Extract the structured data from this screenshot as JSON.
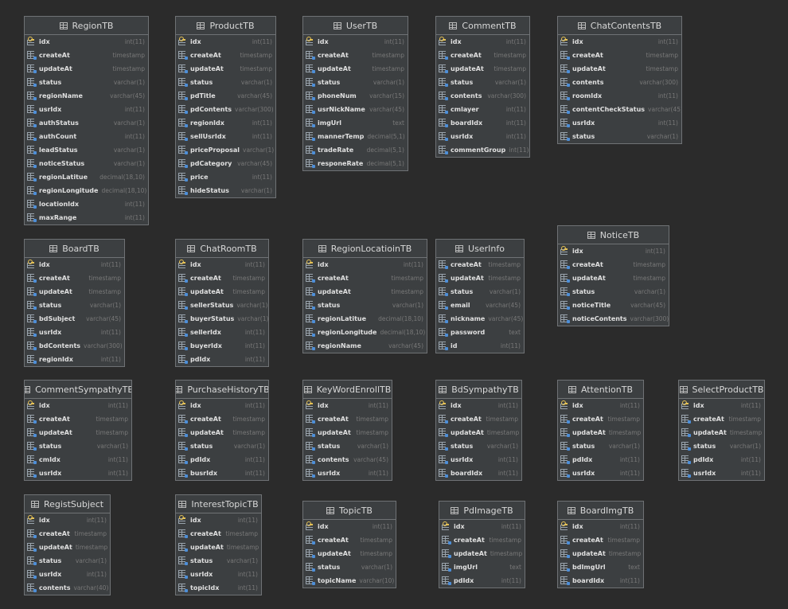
{
  "tables": [
    {
      "name": "RegionTB",
      "columns": [
        {
          "name": "idx",
          "type": "int(11)",
          "pk": true
        },
        {
          "name": "createAt",
          "type": "timestamp"
        },
        {
          "name": "updateAt",
          "type": "timestamp"
        },
        {
          "name": "status",
          "type": "varchar(1)"
        },
        {
          "name": "regionName",
          "type": "varchar(45)"
        },
        {
          "name": "usrIdx",
          "type": "int(11)"
        },
        {
          "name": "authStatus",
          "type": "varchar(1)"
        },
        {
          "name": "authCount",
          "type": "int(11)"
        },
        {
          "name": "leadStatus",
          "type": "varchar(1)"
        },
        {
          "name": "noticeStatus",
          "type": "varchar(1)"
        },
        {
          "name": "regionLatitue",
          "type": "decimal(18,10)"
        },
        {
          "name": "regionLongitude",
          "type": "decimal(18,10)"
        },
        {
          "name": "locationIdx",
          "type": "int(11)"
        },
        {
          "name": "maxRange",
          "type": "int(11)"
        }
      ]
    },
    {
      "name": "ProductTB",
      "columns": [
        {
          "name": "idx",
          "type": "int(11)",
          "pk": true
        },
        {
          "name": "createAt",
          "type": "timestamp"
        },
        {
          "name": "updateAt",
          "type": "timestamp"
        },
        {
          "name": "status",
          "type": "varchar(1)"
        },
        {
          "name": "pdTitle",
          "type": "varchar(45)"
        },
        {
          "name": "pdContents",
          "type": "varchar(300)"
        },
        {
          "name": "regionIdx",
          "type": "int(11)"
        },
        {
          "name": "sellUsrIdx",
          "type": "int(11)"
        },
        {
          "name": "priceProposal",
          "type": "varchar(1)"
        },
        {
          "name": "pdCategory",
          "type": "varchar(45)"
        },
        {
          "name": "price",
          "type": "int(11)"
        },
        {
          "name": "hideStatus",
          "type": "varchar(1)"
        }
      ]
    },
    {
      "name": "UserTB",
      "columns": [
        {
          "name": "idx",
          "type": "int(11)",
          "pk": true
        },
        {
          "name": "createAt",
          "type": "timestamp"
        },
        {
          "name": "updateAt",
          "type": "timestamp"
        },
        {
          "name": "status",
          "type": "varchar(1)"
        },
        {
          "name": "phoneNum",
          "type": "varchar(15)"
        },
        {
          "name": "usrNickName",
          "type": "varchar(45)"
        },
        {
          "name": "imgUrl",
          "type": "text"
        },
        {
          "name": "mannerTemp",
          "type": "decimal(5,1)"
        },
        {
          "name": "tradeRate",
          "type": "decimal(5,1)"
        },
        {
          "name": "responeRate",
          "type": "decimal(5,1)"
        }
      ]
    },
    {
      "name": "CommentTB",
      "columns": [
        {
          "name": "idx",
          "type": "int(11)",
          "pk": true
        },
        {
          "name": "createAt",
          "type": "timestamp"
        },
        {
          "name": "updateAt",
          "type": "timestamp"
        },
        {
          "name": "status",
          "type": "varchar(1)"
        },
        {
          "name": "contents",
          "type": "varchar(300)"
        },
        {
          "name": "cmlayer",
          "type": "int(11)"
        },
        {
          "name": "boardIdx",
          "type": "int(11)"
        },
        {
          "name": "usrIdx",
          "type": "int(11)"
        },
        {
          "name": "commentGroup",
          "type": "int(11)"
        }
      ]
    },
    {
      "name": "ChatContentsTB",
      "columns": [
        {
          "name": "idx",
          "type": "int(11)",
          "pk": true
        },
        {
          "name": "createAt",
          "type": "timestamp"
        },
        {
          "name": "updateAt",
          "type": "timestamp"
        },
        {
          "name": "contents",
          "type": "varchar(300)"
        },
        {
          "name": "roomIdx",
          "type": "int(11)"
        },
        {
          "name": "contentCheckStatus",
          "type": "varchar(45)"
        },
        {
          "name": "usrIdx",
          "type": "int(11)"
        },
        {
          "name": "status",
          "type": "varchar(1)"
        }
      ]
    },
    {
      "name": "BoardTB",
      "columns": [
        {
          "name": "idx",
          "type": "int(11)",
          "pk": true
        },
        {
          "name": "createAt",
          "type": "timestamp"
        },
        {
          "name": "updateAt",
          "type": "timestamp"
        },
        {
          "name": "status",
          "type": "varchar(1)"
        },
        {
          "name": "bdSubject",
          "type": "varchar(45)"
        },
        {
          "name": "usrIdx",
          "type": "int(11)"
        },
        {
          "name": "bdContents",
          "type": "varchar(300)"
        },
        {
          "name": "regionIdx",
          "type": "int(11)"
        }
      ]
    },
    {
      "name": "ChatRoomTB",
      "columns": [
        {
          "name": "idx",
          "type": "int(11)",
          "pk": true
        },
        {
          "name": "createAt",
          "type": "timestamp"
        },
        {
          "name": "updateAt",
          "type": "timestamp"
        },
        {
          "name": "sellerStatus",
          "type": "varchar(1)"
        },
        {
          "name": "buyerStatus",
          "type": "varchar(1)"
        },
        {
          "name": "sellerIdx",
          "type": "int(11)"
        },
        {
          "name": "buyerIdx",
          "type": "int(11)"
        },
        {
          "name": "pdIdx",
          "type": "int(11)"
        }
      ]
    },
    {
      "name": "RegionLocatioinTB",
      "columns": [
        {
          "name": "idx",
          "type": "int(11)",
          "pk": true
        },
        {
          "name": "createAt",
          "type": "timestamp"
        },
        {
          "name": "updateAt",
          "type": "timestamp"
        },
        {
          "name": "status",
          "type": "varchar(1)"
        },
        {
          "name": "regionLatitue",
          "type": "decimal(18,10)"
        },
        {
          "name": "regionLongitude",
          "type": "decimal(18,10)"
        },
        {
          "name": "regionName",
          "type": "varchar(45)"
        }
      ]
    },
    {
      "name": "UserInfo",
      "columns": [
        {
          "name": "createAt",
          "type": "timestamp"
        },
        {
          "name": "updateAt",
          "type": "timestamp"
        },
        {
          "name": "status",
          "type": "varchar(1)"
        },
        {
          "name": "email",
          "type": "varchar(45)"
        },
        {
          "name": "nickname",
          "type": "varchar(45)"
        },
        {
          "name": "password",
          "type": "text"
        },
        {
          "name": "id",
          "type": "int(11)"
        }
      ]
    },
    {
      "name": "NoticeTB",
      "columns": [
        {
          "name": "idx",
          "type": "int(11)",
          "pk": true
        },
        {
          "name": "createAt",
          "type": "timestamp"
        },
        {
          "name": "updateAt",
          "type": "timestamp"
        },
        {
          "name": "status",
          "type": "varchar(1)"
        },
        {
          "name": "noticeTitle",
          "type": "varchar(45)"
        },
        {
          "name": "noticeContents",
          "type": "varchar(300)"
        }
      ]
    },
    {
      "name": "CommentSympathyTB",
      "columns": [
        {
          "name": "idx",
          "type": "int(11)",
          "pk": true
        },
        {
          "name": "createAt",
          "type": "timestamp"
        },
        {
          "name": "updateAt",
          "type": "timestamp"
        },
        {
          "name": "status",
          "type": "varchar(1)"
        },
        {
          "name": "cmIdx",
          "type": "int(11)"
        },
        {
          "name": "usrIdx",
          "type": "int(11)"
        }
      ]
    },
    {
      "name": "PurchaseHistoryTB",
      "columns": [
        {
          "name": "idx",
          "type": "int(11)",
          "pk": true
        },
        {
          "name": "createAt",
          "type": "timestamp"
        },
        {
          "name": "updateAt",
          "type": "timestamp"
        },
        {
          "name": "status",
          "type": "varchar(1)"
        },
        {
          "name": "pdIdx",
          "type": "int(11)"
        },
        {
          "name": "busrIdx",
          "type": "int(11)"
        }
      ]
    },
    {
      "name": "KeyWordEnrollTB",
      "columns": [
        {
          "name": "idx",
          "type": "int(11)",
          "pk": true
        },
        {
          "name": "createAt",
          "type": "timestamp"
        },
        {
          "name": "updateAt",
          "type": "timestamp"
        },
        {
          "name": "status",
          "type": "varchar(1)"
        },
        {
          "name": "contents",
          "type": "varchar(45)"
        },
        {
          "name": "usrIdx",
          "type": "int(11)"
        }
      ]
    },
    {
      "name": "BdSympathyTB",
      "columns": [
        {
          "name": "idx",
          "type": "int(11)",
          "pk": true
        },
        {
          "name": "createAt",
          "type": "timestamp"
        },
        {
          "name": "updateAt",
          "type": "timestamp"
        },
        {
          "name": "status",
          "type": "varchar(1)"
        },
        {
          "name": "usrIdx",
          "type": "int(11)"
        },
        {
          "name": "boardIdx",
          "type": "int(11)"
        }
      ]
    },
    {
      "name": "AttentionTB",
      "columns": [
        {
          "name": "idx",
          "type": "int(11)",
          "pk": true
        },
        {
          "name": "createAt",
          "type": "timestamp"
        },
        {
          "name": "updateAt",
          "type": "timestamp"
        },
        {
          "name": "status",
          "type": "varchar(1)"
        },
        {
          "name": "pdIdx",
          "type": "int(11)"
        },
        {
          "name": "usrIdx",
          "type": "int(11)"
        }
      ]
    },
    {
      "name": "SelectProductTB",
      "columns": [
        {
          "name": "idx",
          "type": "int(11)",
          "pk": true
        },
        {
          "name": "createAt",
          "type": "timestamp"
        },
        {
          "name": "updateAt",
          "type": "timestamp"
        },
        {
          "name": "status",
          "type": "varchar(1)"
        },
        {
          "name": "pdIdx",
          "type": "int(11)"
        },
        {
          "name": "usrIdx",
          "type": "int(11)"
        }
      ]
    },
    {
      "name": "RegistSubject",
      "columns": [
        {
          "name": "idx",
          "type": "int(11)",
          "pk": true
        },
        {
          "name": "createAt",
          "type": "timestamp"
        },
        {
          "name": "updateAt",
          "type": "timestamp"
        },
        {
          "name": "status",
          "type": "varchar(1)"
        },
        {
          "name": "usrIdx",
          "type": "int(11)"
        },
        {
          "name": "contents",
          "type": "varchar(40)"
        }
      ]
    },
    {
      "name": "InterestTopicTB",
      "columns": [
        {
          "name": "idx",
          "type": "int(11)",
          "pk": true
        },
        {
          "name": "createAt",
          "type": "timestamp"
        },
        {
          "name": "updateAt",
          "type": "timestamp"
        },
        {
          "name": "status",
          "type": "varchar(1)"
        },
        {
          "name": "usrIdx",
          "type": "int(11)"
        },
        {
          "name": "topicIdx",
          "type": "int(11)"
        }
      ]
    },
    {
      "name": "TopicTB",
      "columns": [
        {
          "name": "idx",
          "type": "int(11)",
          "pk": true
        },
        {
          "name": "createAt",
          "type": "timestamp"
        },
        {
          "name": "updateAt",
          "type": "timestamp"
        },
        {
          "name": "status",
          "type": "varchar(1)"
        },
        {
          "name": "topicName",
          "type": "varchar(10)"
        }
      ]
    },
    {
      "name": "PdImageTB",
      "columns": [
        {
          "name": "idx",
          "type": "int(11)",
          "pk": true
        },
        {
          "name": "createAt",
          "type": "timestamp"
        },
        {
          "name": "updateAt",
          "type": "timestamp"
        },
        {
          "name": "imgUrl",
          "type": "text"
        },
        {
          "name": "pdIdx",
          "type": "int(11)"
        }
      ]
    },
    {
      "name": "BoardImgTB",
      "columns": [
        {
          "name": "idx",
          "type": "int(11)",
          "pk": true
        },
        {
          "name": "createAt",
          "type": "timestamp"
        },
        {
          "name": "updateAt",
          "type": "timestamp"
        },
        {
          "name": "bdImgUrl",
          "type": "text"
        },
        {
          "name": "boardIdx",
          "type": "int(11)"
        }
      ]
    }
  ]
}
